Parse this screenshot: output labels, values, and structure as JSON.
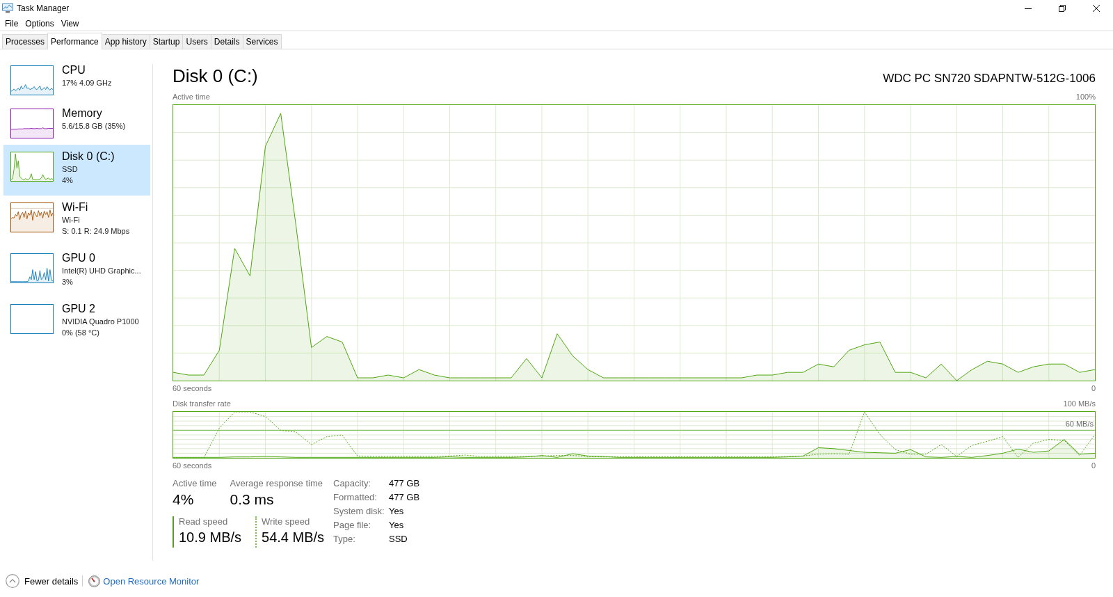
{
  "window": {
    "title": "Task Manager"
  },
  "menu": [
    {
      "label": "File"
    },
    {
      "label": "Options"
    },
    {
      "label": "View"
    }
  ],
  "tabs": [
    {
      "label": "Processes",
      "selected": false
    },
    {
      "label": "Performance",
      "selected": true
    },
    {
      "label": "App history",
      "selected": false
    },
    {
      "label": "Startup",
      "selected": false
    },
    {
      "label": "Users",
      "selected": false
    },
    {
      "label": "Details",
      "selected": false
    },
    {
      "label": "Services",
      "selected": false
    }
  ],
  "sidebar": {
    "items": [
      {
        "name": "CPU",
        "details": [
          "17% 4.09 GHz"
        ],
        "color": "#117dbb",
        "selected": false
      },
      {
        "name": "Memory",
        "details": [
          "5.6/15.8 GB (35%)"
        ],
        "color": "#8b12ae",
        "selected": false
      },
      {
        "name": "Disk 0 (C:)",
        "details": [
          "SSD",
          "4%"
        ],
        "color": "#4da60c",
        "selected": true
      },
      {
        "name": "Wi-Fi",
        "details": [
          "Wi-Fi",
          "S: 0.1 R: 24.9 Mbps"
        ],
        "color": "#a74f01",
        "selected": false
      },
      {
        "name": "GPU 0",
        "details": [
          "Intel(R) UHD Graphic...",
          "3%"
        ],
        "color": "#117dbb",
        "selected": false
      },
      {
        "name": "GPU 2",
        "details": [
          "NVIDIA Quadro P1000",
          "0% (58 °C)"
        ],
        "color": "#117dbb",
        "selected": false
      }
    ]
  },
  "detail": {
    "title": "Disk 0 (C:)",
    "model": "WDC PC SN720 SDAPNTW-512G-1006",
    "graphs": [
      {
        "kind": "activity",
        "title": "Active time",
        "top_label": "100%",
        "span_label": "60 seconds",
        "end_label": "0"
      },
      {
        "kind": "transfer",
        "title": "Disk transfer rate",
        "top_label": "100 MB/s",
        "line_label": "60 MB/s",
        "span_label": "60 seconds",
        "end_label": "0"
      }
    ],
    "stats": [
      {
        "label": "Active time",
        "value": "4%"
      },
      {
        "label": "Average response time",
        "value": "0.3 ms"
      }
    ],
    "speeds": [
      {
        "label": "Read speed",
        "value": "10.9 MB/s",
        "kind": "solid"
      },
      {
        "label": "Write speed",
        "value": "54.4 MB/s",
        "kind": "dotted"
      }
    ],
    "properties": [
      {
        "label": "Capacity:",
        "value": "477 GB"
      },
      {
        "label": "Formatted:",
        "value": "477 GB"
      },
      {
        "label": "System disk:",
        "value": "Yes"
      },
      {
        "label": "Page file:",
        "value": "Yes"
      },
      {
        "label": "Type:",
        "value": "SSD"
      }
    ]
  },
  "footer": {
    "toggle_button": "Fewer details",
    "resource_monitor_link": "Open Resource Monitor"
  }
}
